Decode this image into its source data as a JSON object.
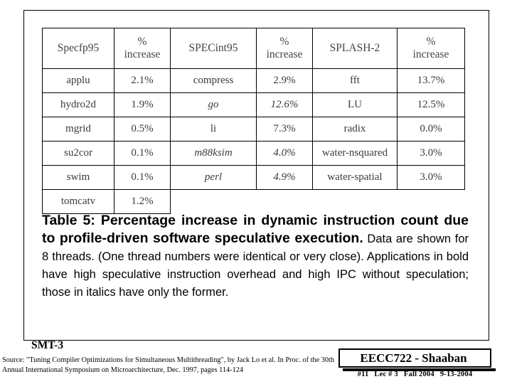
{
  "slide": {
    "smt_label": "SMT-3",
    "source_note": "Source: \"Tuning Compiler Optimizations for Simultaneous Multithreading\", by Jack Lo et al. In Proc. of the 30th Annual International Symposium on Microarchitecture, Dec. 1997, pages 114-124",
    "footer": {
      "title": "EECC722 - Shaaban",
      "slide_number": "#11",
      "lecture": "Lec # 3",
      "term": "Fall 2004",
      "date": "9-13-2004"
    }
  },
  "table": {
    "headers": [
      "Specfp95",
      "%\nincrease",
      "SPECint95",
      "%\nincrease",
      "SPLASH-2",
      "%\nincrease"
    ],
    "headers_flat": [
      "Specfp95",
      "% increase",
      "SPECint95",
      "% increase",
      "SPLASH-2",
      "% increase"
    ],
    "rows": [
      {
        "fp_name": "applu",
        "fp_value": "2.1%",
        "fp_style": "normal",
        "int_name": "compress",
        "int_value": "2.9%",
        "int_style": "normal",
        "sp_name": "fft",
        "sp_value": "13.7%",
        "sp_style": "bold"
      },
      {
        "fp_name": "hydro2d",
        "fp_value": "1.9%",
        "fp_style": "normal",
        "int_name": "go",
        "int_value": "12.6%",
        "int_style": "italic",
        "sp_name": "LU",
        "sp_value": "12.5%",
        "sp_style": "bold"
      },
      {
        "fp_name": "mgrid",
        "fp_value": "0.5%",
        "fp_style": "normal",
        "int_name": "li",
        "int_value": "7.3%",
        "int_style": "bold",
        "sp_name": "radix",
        "sp_value": "0.0%",
        "sp_style": "normal"
      },
      {
        "fp_name": "su2cor",
        "fp_value": "0.1%",
        "fp_style": "normal",
        "int_name": "m88ksim",
        "int_value": "4.0%",
        "int_style": "italic",
        "sp_name": "water-nsquared",
        "sp_value": "3.0%",
        "sp_style": "normal"
      },
      {
        "fp_name": "swim",
        "fp_value": "0.1%",
        "fp_style": "normal",
        "int_name": "perl",
        "int_value": "4.9%",
        "int_style": "italic",
        "sp_name": "water-spatial",
        "sp_value": "3.0%",
        "sp_style": "normal"
      },
      {
        "fp_name": "tomcatv",
        "fp_value": "1.2%",
        "fp_style": "normal",
        "int_name": "",
        "int_value": "",
        "int_style": "normal",
        "sp_name": "",
        "sp_value": "",
        "sp_style": "normal"
      }
    ]
  },
  "caption": {
    "bold_part": "Table 5: Percentage increase in dynamic instruction count due to profile-driven software speculative execution.",
    "normal_part": " Data are shown for 8 threads. (One thread numbers were identical or very close). Applications in bold have high speculative instruction overhead and high IPC without speculation; those in italics have only the former."
  }
}
